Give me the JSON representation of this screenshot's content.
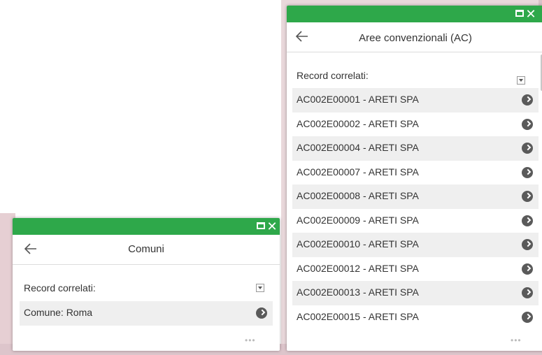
{
  "popup_comuni": {
    "title": "Comuni",
    "section_label": "Record correlati:",
    "items": [
      {
        "label": "Comune: Roma"
      }
    ],
    "more_label": "•••"
  },
  "popup_aree": {
    "title": "Aree convenzionali (AC)",
    "section_label": "Record correlati:",
    "items": [
      {
        "label": "AC002E00001 - ARETI SPA"
      },
      {
        "label": "AC002E00002 - ARETI SPA"
      },
      {
        "label": "AC002E00004 - ARETI SPA"
      },
      {
        "label": "AC002E00007 - ARETI SPA"
      },
      {
        "label": "AC002E00008 - ARETI SPA"
      },
      {
        "label": "AC002E00009 - ARETI SPA"
      },
      {
        "label": "AC002E00010 - ARETI SPA"
      },
      {
        "label": "AC002E00012 - ARETI SPA"
      },
      {
        "label": "AC002E00013 - ARETI SPA"
      },
      {
        "label": "AC002E00015 - ARETI SPA"
      }
    ],
    "more_label": "•••"
  },
  "colors": {
    "titlebar": "#2ea84a",
    "row_shade": "#efefef",
    "go_icon": "#5a5a5a"
  },
  "icons": {
    "maximize": "maximize-icon",
    "close": "close-icon",
    "back": "back-arrow-icon",
    "dropdown": "dropdown-icon",
    "go": "go-arrow-icon"
  }
}
